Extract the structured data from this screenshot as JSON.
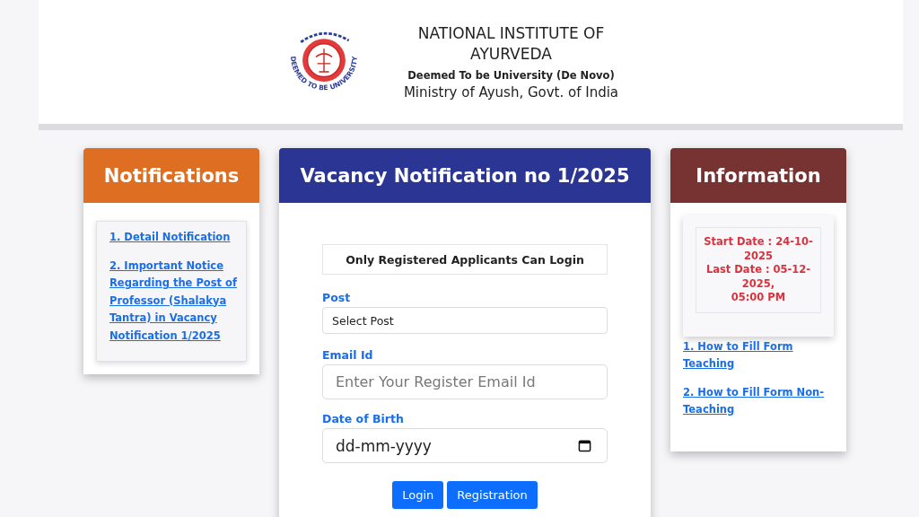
{
  "header": {
    "logo_text": "DEEMED TO BE UNIVERSITY",
    "title": "NATIONAL INSTITUTE OF AYURVEDA",
    "subtitle": "Deemed To be University (De Novo)",
    "ministry": "Ministry of Ayush, Govt. of India"
  },
  "notifications": {
    "title": "Notifications",
    "links": [
      "1. Detail Notification",
      "2. Important Notice Regarding the Post of Professor (Shalakya Tantra) in Vacancy Notification 1/2025"
    ]
  },
  "vacancy": {
    "title": "Vacancy Notification no 1/2025",
    "notice": "Only Registered Applicants Can Login",
    "fields": [
      {
        "kind": "select",
        "label": "Post",
        "value": "Select Post"
      },
      {
        "kind": "text",
        "label": "Email Id",
        "placeholder": "Enter Your Register Email Id"
      },
      {
        "kind": "date",
        "label": "Date of Birth",
        "placeholder": "dd-mm-yyyy"
      }
    ],
    "buttons": [
      "Login",
      "Registration"
    ]
  },
  "information": {
    "title": "Information",
    "dates": [
      "Start Date : 24-10-2025",
      "Last Date : 05-12-2025,",
      "05:00 PM"
    ],
    "links": [
      "1. How to Fill Form Teaching",
      "2. How to Fill Form Non-Teaching"
    ]
  }
}
